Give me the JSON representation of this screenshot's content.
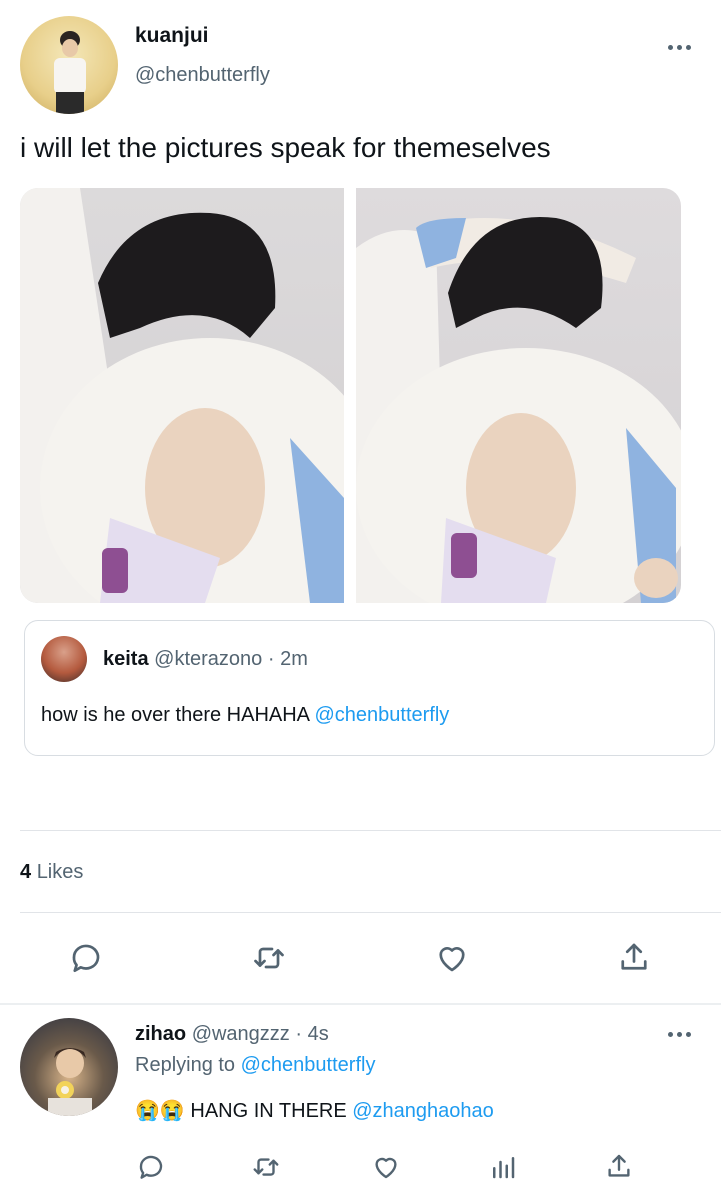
{
  "main_tweet": {
    "display_name": "kuanjui",
    "handle": "@chenbutterfly",
    "text": "i will let the pictures speak for themeselves"
  },
  "quoted_tweet": {
    "display_name": "keita",
    "handle": "@kterazono",
    "separator": "·",
    "time": "2m",
    "text": "how is he over there HAHAHA ",
    "mention": "@chenbutterfly"
  },
  "stats": {
    "likes_count": "4",
    "likes_label": "Likes"
  },
  "reply": {
    "display_name": "zihao",
    "handle": "@wangzzz",
    "separator": "·",
    "time": "4s",
    "replying_prefix": "Replying to ",
    "replying_to": "@chenbutterfly",
    "emoji": "😭😭",
    "text": " HANG IN THERE ",
    "mention": "@zhanghaohao"
  },
  "icons": {
    "reply": "speech-bubble-icon",
    "retweet": "retweet-icon",
    "like": "heart-icon",
    "share": "share-icon",
    "analytics": "analytics-icon",
    "more": "more-dots-icon"
  },
  "colors": {
    "accent": "#1d9bf0",
    "secondary_text": "#536471",
    "divider": "#e1e4e8",
    "icon": "#536471"
  }
}
